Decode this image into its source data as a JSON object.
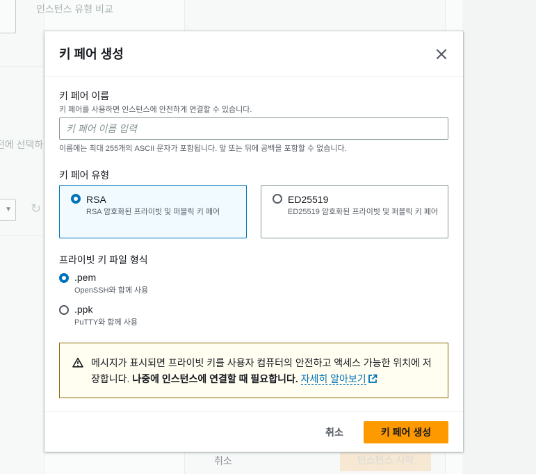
{
  "background": {
    "compare_label": "인스턴스 유형 비교",
    "select_fragment": "전에 선택하",
    "cancel_label": "취소",
    "launch_label": "인스턴스 시작"
  },
  "modal": {
    "title": "키 페어 생성",
    "name": {
      "label": "키 페어 이름",
      "description": "키 페어를 사용하면 인스턴스에 안전하게 연결할 수 있습니다.",
      "placeholder": "키 페어 이름 입력",
      "value": "",
      "constraint": "이름에는 최대 255개의 ASCII 문자가 포함됩니다. 앞 또는 뒤에 공백을 포함할 수 없습니다."
    },
    "type": {
      "label": "키 페어 유형",
      "options": [
        {
          "title": "RSA",
          "description": "RSA 암호화된 프라이빗 및 퍼블릭 키 페어",
          "selected": true
        },
        {
          "title": "ED25519",
          "description": "ED25519 암호화된 프라이빗 및 퍼블릭 키 페어",
          "selected": false
        }
      ]
    },
    "format": {
      "label": "프라이빗 키 파일 형식",
      "options": [
        {
          "title": ".pem",
          "description": "OpenSSH와 함께 사용",
          "selected": true
        },
        {
          "title": ".ppk",
          "description": "PuTTY와 함께 사용",
          "selected": false
        }
      ]
    },
    "alert": {
      "text_plain": "메시지가 표시되면 프라이빗 키를 사용자 컴퓨터의 안전하고 액세스 가능한 위치에 저장합니다. ",
      "text_bold": "나중에 인스턴스에 연결할 때 필요합니다.",
      "link": "자세히 알아보기"
    },
    "footer": {
      "cancel_label": "취소",
      "create_label": "키 페어 생성"
    },
    "colors": {
      "accent": "#0073bb",
      "primary_button": "#ff9900",
      "warning_border": "#8d6605",
      "warning_bg": "#fffef0"
    }
  }
}
